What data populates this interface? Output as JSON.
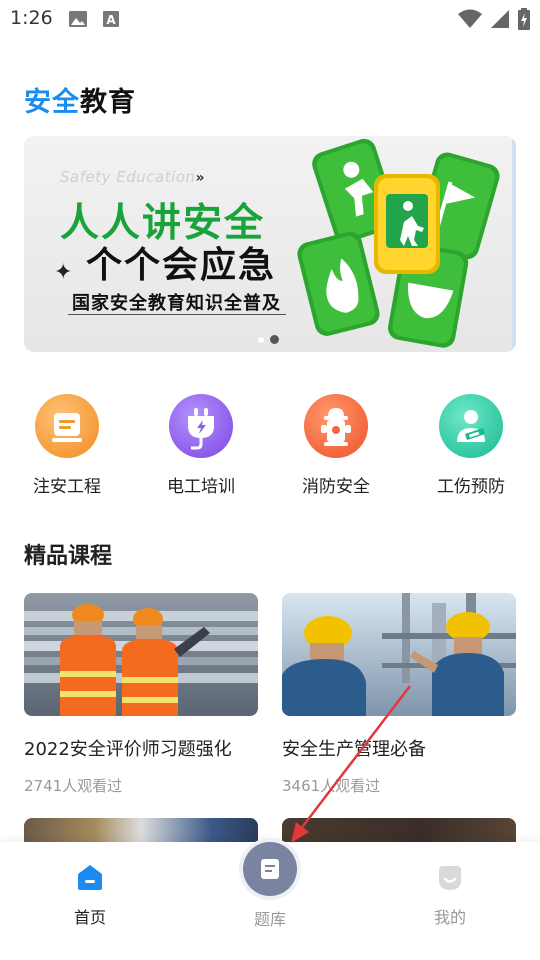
{
  "status_bar": {
    "time": "1:26",
    "icons": [
      "image-icon",
      "keyboard-a-icon",
      "wifi-icon",
      "signal-icon",
      "battery-charging-icon"
    ]
  },
  "header": {
    "title_part1": "安全",
    "title_part2": "教育"
  },
  "banner": {
    "subtitle_en": "Safety Education",
    "subtitle_arrows": "»",
    "line1": "人人讲安全",
    "line2": "个个会应急",
    "line3": "国家安全教育知识全普及",
    "dot_count": 2,
    "active_dot": 1
  },
  "categories": [
    {
      "label": "注安工程",
      "icon": "document-icon",
      "color": "#f59a2c"
    },
    {
      "label": "电工培训",
      "icon": "plug-icon",
      "color": "#8d5ee6"
    },
    {
      "label": "消防安全",
      "icon": "hydrant-icon",
      "color": "#f4663a"
    },
    {
      "label": "工伤预防",
      "icon": "injured-person-icon",
      "color": "#23c9a4"
    }
  ],
  "section": {
    "title": "精品课程"
  },
  "courses": [
    {
      "title": "2022安全评价师习题强化",
      "views": "2741人观看过"
    },
    {
      "title": "安全生产管理必备",
      "views": "3461人观看过"
    }
  ],
  "bottom_nav": {
    "items": [
      {
        "label": "首页",
        "icon": "home-icon",
        "active": true
      },
      {
        "label": "题库",
        "icon": "question-bank-icon",
        "active": false
      },
      {
        "label": "我的",
        "icon": "profile-icon",
        "active": false
      }
    ]
  },
  "colors": {
    "brand_blue": "#1a8cf0",
    "green": "#19a33b",
    "annotation_red": "#e0383b"
  }
}
